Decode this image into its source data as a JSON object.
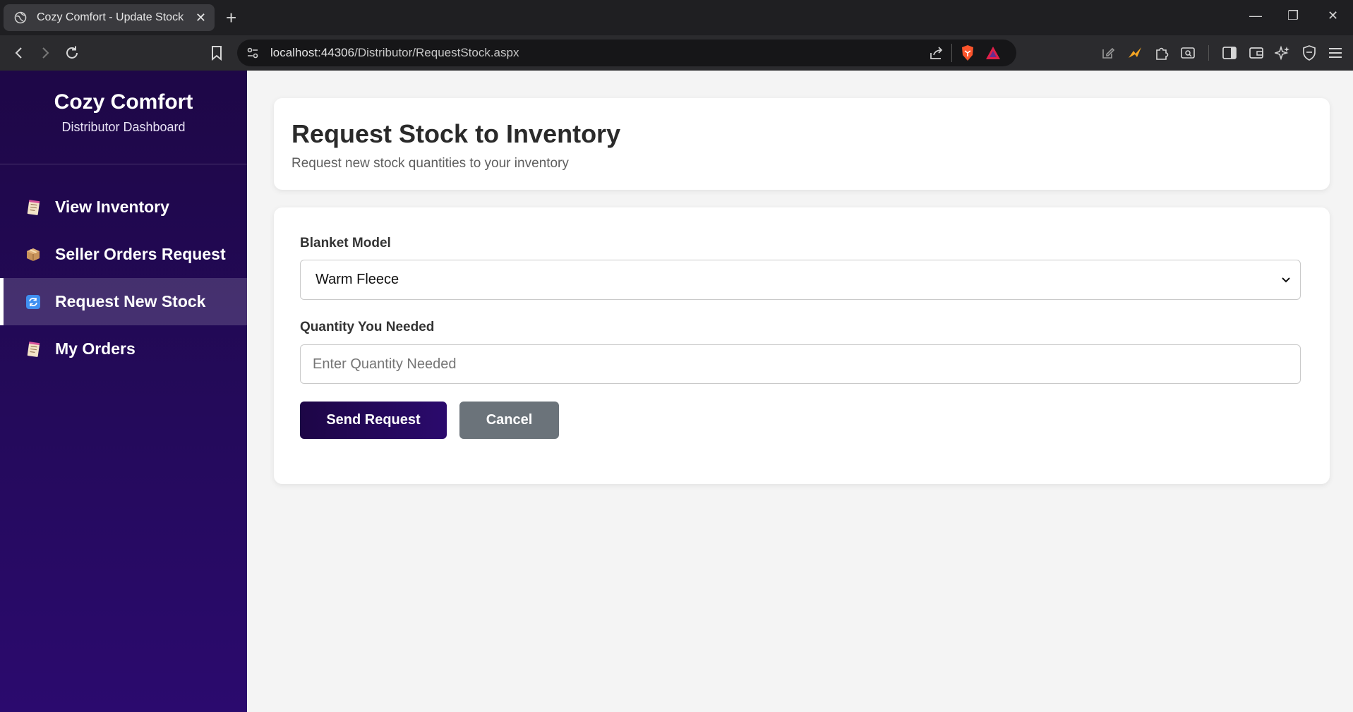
{
  "browser": {
    "tab_title": "Cozy Comfort - Update Stock",
    "tab_close": "✕",
    "new_tab": "+",
    "url_host": "localhost:44306",
    "url_path": "/Distributor/RequestStock.aspx",
    "window_controls": {
      "minimize": "—",
      "restore": "❐",
      "close": "✕"
    }
  },
  "sidebar": {
    "brand_title": "Cozy Comfort",
    "brand_subtitle": "Distributor Dashboard",
    "items": [
      {
        "label": "View Inventory",
        "icon": "notepad-icon",
        "active": false
      },
      {
        "label": "Seller Orders Request",
        "icon": "package-icon",
        "active": false
      },
      {
        "label": "Request New Stock",
        "icon": "refresh-icon",
        "active": true
      },
      {
        "label": "My Orders",
        "icon": "notepad-icon",
        "active": false
      }
    ]
  },
  "header": {
    "title": "Request Stock to Inventory",
    "subtitle": "Request new stock quantities to your inventory"
  },
  "form": {
    "model_label": "Blanket Model",
    "model_value": "Warm Fleece",
    "quantity_label": "Quantity You Needed",
    "quantity_placeholder": "Enter Quantity Needed",
    "quantity_value": "",
    "submit_label": "Send Request",
    "cancel_label": "Cancel"
  },
  "colors": {
    "sidebar_top": "#1e0747",
    "sidebar_bottom": "#2b0a6e",
    "primary_button": "#240850",
    "secondary_button": "#6b737a",
    "page_background": "#f4f4f4"
  }
}
